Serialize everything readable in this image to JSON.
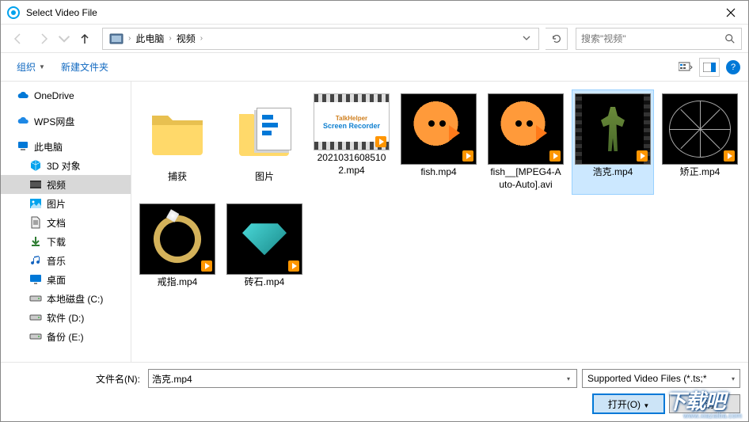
{
  "window": {
    "title": "Select Video File"
  },
  "breadcrumb": {
    "root": "此电脑",
    "folder": "视频"
  },
  "search": {
    "placeholder": "搜索\"视频\""
  },
  "toolbar": {
    "organize": "组织",
    "newfolder": "新建文件夹"
  },
  "sidebar": [
    {
      "label": "OneDrive",
      "icon": "cloud",
      "color": "#0078d7",
      "indent": false
    },
    {
      "label": "WPS网盘",
      "icon": "cloud",
      "color": "#1e88e5",
      "indent": false
    },
    {
      "label": "此电脑",
      "icon": "pc",
      "color": "#0078d7",
      "indent": false
    },
    {
      "label": "3D 对象",
      "icon": "cube",
      "color": "#00a2ed",
      "indent": true
    },
    {
      "label": "视频",
      "icon": "video",
      "color": "#555",
      "indent": true,
      "selected": true
    },
    {
      "label": "图片",
      "icon": "picture",
      "color": "#00a2ed",
      "indent": true
    },
    {
      "label": "文档",
      "icon": "doc",
      "color": "#555",
      "indent": true
    },
    {
      "label": "下载",
      "icon": "download",
      "color": "#2e7d32",
      "indent": true
    },
    {
      "label": "音乐",
      "icon": "music",
      "color": "#1565c0",
      "indent": true
    },
    {
      "label": "桌面",
      "icon": "desktop",
      "color": "#0078d7",
      "indent": true
    },
    {
      "label": "本地磁盘 (C:)",
      "icon": "drive",
      "color": "#555",
      "indent": true
    },
    {
      "label": "软件 (D:)",
      "icon": "drive",
      "color": "#555",
      "indent": true
    },
    {
      "label": "备份 (E:)",
      "icon": "drive",
      "color": "#555",
      "indent": true
    }
  ],
  "items": [
    {
      "label": "捕获",
      "kind": "folder"
    },
    {
      "label": "图片",
      "kind": "folder-pics"
    },
    {
      "label": "2021031608510\n2.mp4",
      "kind": "video-white"
    },
    {
      "label": "fish.mp4",
      "kind": "video-black",
      "visual": "fish"
    },
    {
      "label": "fish__[MPEG4-A\nuto-Auto].avi",
      "kind": "video-black",
      "visual": "fish"
    },
    {
      "label": "浩克.mp4",
      "kind": "video-black",
      "visual": "hulk",
      "selected": true
    },
    {
      "label": "矫正.mp4",
      "kind": "video-black",
      "visual": "wheel"
    },
    {
      "label": "戒指.mp4",
      "kind": "video-black",
      "visual": "ring"
    },
    {
      "label": "砖石.mp4",
      "kind": "video-black",
      "visual": "diamond"
    }
  ],
  "bottom": {
    "filename_label": "文件名(N):",
    "filename_value": "浩克.mp4",
    "filter": "Supported Video Files (*.ts;*",
    "open": "打开(O)",
    "cancel": "取消"
  },
  "watermark": {
    "text": "下载吧",
    "sub": "www.xiazaiba.com"
  },
  "recorder_text": {
    "l1": "TalkHelper",
    "l2": "Screen Recorder"
  }
}
